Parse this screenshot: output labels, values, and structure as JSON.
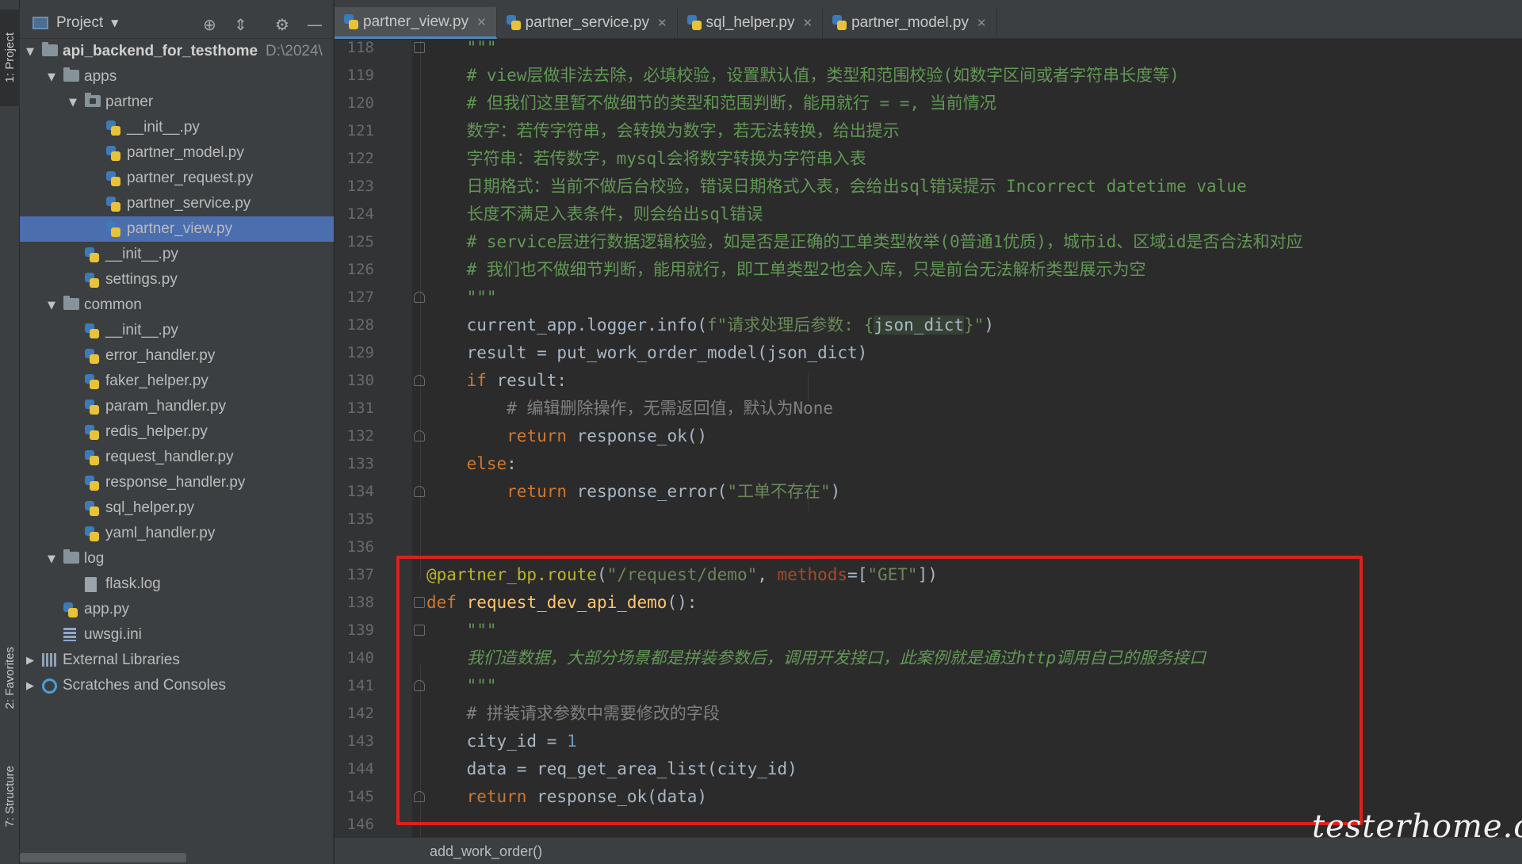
{
  "tool_strip": {
    "project_tab": "1: Project",
    "favorites_tab": "2: Favorites",
    "structure_tab": "7: Structure"
  },
  "project_panel": {
    "title": "Project",
    "icons": [
      "target-icon",
      "collapse-icon",
      "gear-icon",
      "minimize-icon"
    ],
    "tree": [
      {
        "label": "api_backend_for_testhome",
        "path": "D:\\2024\\",
        "type": "folder",
        "expanded": true
      },
      {
        "label": "apps",
        "type": "folder",
        "expanded": true
      },
      {
        "label": "partner",
        "type": "package",
        "expanded": true
      },
      {
        "label": "__init__.py",
        "type": "python"
      },
      {
        "label": "partner_model.py",
        "type": "python"
      },
      {
        "label": "partner_request.py",
        "type": "python"
      },
      {
        "label": "partner_service.py",
        "type": "python"
      },
      {
        "label": "partner_view.py",
        "type": "python",
        "selected": true
      },
      {
        "label": "__init__.py",
        "type": "python"
      },
      {
        "label": "settings.py",
        "type": "python"
      },
      {
        "label": "common",
        "type": "folder",
        "expanded": true
      },
      {
        "label": "__init__.py",
        "type": "python"
      },
      {
        "label": "error_handler.py",
        "type": "python"
      },
      {
        "label": "faker_helper.py",
        "type": "python"
      },
      {
        "label": "param_handler.py",
        "type": "python"
      },
      {
        "label": "redis_helper.py",
        "type": "python"
      },
      {
        "label": "request_handler.py",
        "type": "python"
      },
      {
        "label": "response_handler.py",
        "type": "python"
      },
      {
        "label": "sql_helper.py",
        "type": "python"
      },
      {
        "label": "yaml_handler.py",
        "type": "python"
      },
      {
        "label": "log",
        "type": "folder",
        "expanded": true
      },
      {
        "label": "flask.log",
        "type": "file"
      },
      {
        "label": "app.py",
        "type": "python"
      },
      {
        "label": "uwsgi.ini",
        "type": "ini"
      },
      {
        "label": "External Libraries",
        "type": "library",
        "expanded": false
      },
      {
        "label": "Scratches and Consoles",
        "type": "scratch",
        "expanded": false
      }
    ]
  },
  "tabs": [
    {
      "label": "partner_view.py",
      "active": true
    },
    {
      "label": "partner_service.py",
      "active": false
    },
    {
      "label": "sql_helper.py",
      "active": false
    },
    {
      "label": "partner_model.py",
      "active": false
    }
  ],
  "editor": {
    "lines": [
      {
        "n": "118",
        "tokens": [
          [
            "    ",
            ""
          ],
          [
            "\"\"\"",
            "ds"
          ]
        ]
      },
      {
        "n": "119",
        "tokens": [
          [
            "    ",
            ""
          ],
          [
            "# view层做非法去除，必填校验，设置默认值，类型和范围校验(如数字区间或者字符串长度等)",
            "ds"
          ]
        ]
      },
      {
        "n": "120",
        "tokens": [
          [
            "    ",
            ""
          ],
          [
            "# 但我们这里暂不做细节的类型和范围判断，能用就行 = =, 当前情况",
            "ds"
          ]
        ]
      },
      {
        "n": "121",
        "tokens": [
          [
            "    ",
            ""
          ],
          [
            "数字：若传字符串，会转换为数字，若无法转换，给出提示",
            "ds"
          ]
        ]
      },
      {
        "n": "122",
        "tokens": [
          [
            "    ",
            ""
          ],
          [
            "字符串：若传数字，mysql会将数字转换为字符串入表",
            "ds"
          ]
        ]
      },
      {
        "n": "123",
        "tokens": [
          [
            "    ",
            ""
          ],
          [
            "日期格式：当前不做后台校验，错误日期格式入表，会给出sql错误提示 Incorrect datetime value",
            "ds"
          ]
        ]
      },
      {
        "n": "124",
        "tokens": [
          [
            "    ",
            ""
          ],
          [
            "长度不满足入表条件，则会给出sql错误",
            "ds"
          ]
        ]
      },
      {
        "n": "125",
        "tokens": [
          [
            "    ",
            ""
          ],
          [
            "# service层进行数据逻辑校验，如是否是正确的工单类型枚举(0普通1优质)，城市id、区域id是否合法和对应",
            "ds"
          ]
        ]
      },
      {
        "n": "126",
        "tokens": [
          [
            "    ",
            ""
          ],
          [
            "# 我们也不做细节判断，能用就行，即工单类型2也会入库，只是前台无法解析类型展示为空",
            "ds"
          ]
        ]
      },
      {
        "n": "127",
        "tokens": [
          [
            "    ",
            ""
          ],
          [
            "\"\"\"",
            "ds"
          ]
        ]
      },
      {
        "n": "128",
        "tokens": [
          [
            "    current_app.logger.info(",
            ""
          ],
          [
            "f\"请求处理后参数: {",
            "str"
          ],
          [
            "json_dict",
            "hl"
          ],
          [
            "}\"",
            "str"
          ],
          [
            ")",
            ""
          ]
        ]
      },
      {
        "n": "129",
        "tokens": [
          [
            "    result = put_work_order_model(json_dict)",
            ""
          ]
        ]
      },
      {
        "n": "130",
        "tokens": [
          [
            "    ",
            ""
          ],
          [
            "if",
            "kw"
          ],
          [
            " result:",
            ""
          ]
        ]
      },
      {
        "n": "131",
        "tokens": [
          [
            "        ",
            ""
          ],
          [
            "# 编辑删除操作，无需返回值，默认为None",
            "cm"
          ]
        ]
      },
      {
        "n": "132",
        "tokens": [
          [
            "        ",
            ""
          ],
          [
            "return",
            "kw"
          ],
          [
            " response_ok()",
            ""
          ]
        ]
      },
      {
        "n": "133",
        "tokens": [
          [
            "    ",
            ""
          ],
          [
            "else",
            "kw"
          ],
          [
            ":",
            ""
          ]
        ]
      },
      {
        "n": "134",
        "tokens": [
          [
            "        ",
            ""
          ],
          [
            "return",
            "kw"
          ],
          [
            " response_error(",
            ""
          ],
          [
            "\"工单不存在\"",
            "str"
          ],
          [
            ")",
            ""
          ]
        ]
      },
      {
        "n": "135",
        "tokens": []
      },
      {
        "n": "136",
        "tokens": []
      },
      {
        "n": "137",
        "tokens": [
          [
            "@partner_bp.route",
            "dec"
          ],
          [
            "(",
            ""
          ],
          [
            "\"/request/demo\"",
            "str"
          ],
          [
            ", ",
            ""
          ],
          [
            "methods",
            "kwarg"
          ],
          [
            "=[",
            ""
          ],
          [
            "\"GET\"",
            "str"
          ],
          [
            "])",
            ""
          ]
        ]
      },
      {
        "n": "138",
        "tokens": [
          [
            "def",
            "kw"
          ],
          [
            " ",
            ""
          ],
          [
            "request_dev_api_demo",
            "fn"
          ],
          [
            "():",
            ""
          ]
        ]
      },
      {
        "n": "139",
        "tokens": [
          [
            "    ",
            ""
          ],
          [
            "\"\"\"",
            "ds"
          ]
        ]
      },
      {
        "n": "140",
        "tokens": [
          [
            "    ",
            ""
          ],
          [
            "我们造数据，大部分场景都是拼装参数后，调用开发接口，此案例就是通过http调用自己的服务接口",
            "dsi"
          ]
        ]
      },
      {
        "n": "141",
        "tokens": [
          [
            "    ",
            ""
          ],
          [
            "\"\"\"",
            "ds"
          ]
        ]
      },
      {
        "n": "142",
        "tokens": [
          [
            "    ",
            ""
          ],
          [
            "# 拼装请求参数中需要修改的字段",
            "cm"
          ]
        ]
      },
      {
        "n": "143",
        "tokens": [
          [
            "    city_id = ",
            ""
          ],
          [
            "1",
            "num"
          ]
        ]
      },
      {
        "n": "144",
        "tokens": [
          [
            "    data = req_get_area_list(city_id)",
            ""
          ]
        ]
      },
      {
        "n": "145",
        "tokens": [
          [
            "    ",
            ""
          ],
          [
            "return",
            "kw"
          ],
          [
            " response_ok(data)",
            ""
          ]
        ]
      },
      {
        "n": "146",
        "tokens": []
      }
    ]
  },
  "breadcrumb": "add_work_order()",
  "watermark": "testerhome.com",
  "colors": {
    "accent": "#4b6eaf",
    "highlight_box": "#e0201c",
    "keyword": "#cc7832",
    "string": "#6a8759",
    "docstring": "#629755"
  }
}
